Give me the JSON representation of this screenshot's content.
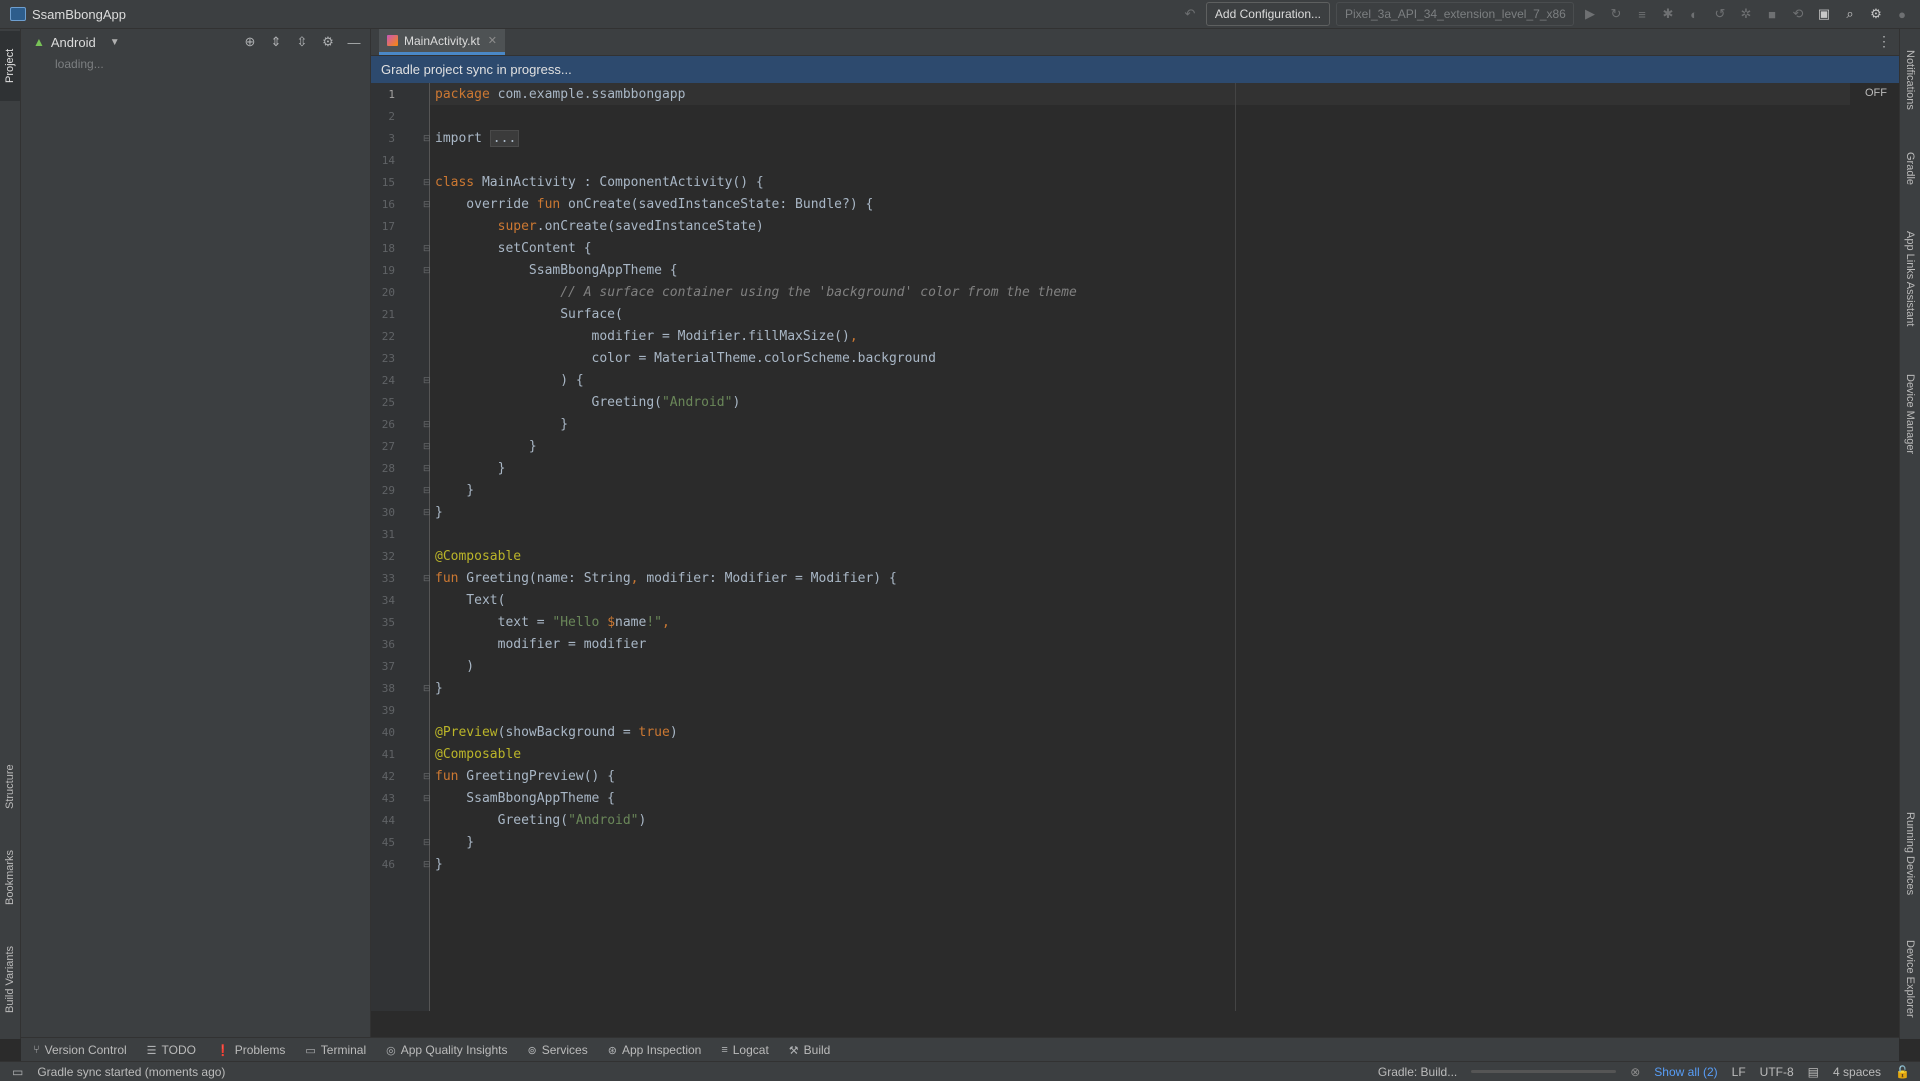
{
  "window": {
    "title": "SsamBbongApp"
  },
  "toolbar": {
    "add_configuration": "Add Configuration...",
    "device": "Pixel_3a_API_34_extension_level_7_x86"
  },
  "left_strip": {
    "project": "Project",
    "structure": "Structure",
    "bookmarks": "Bookmarks",
    "build_variants": "Build Variants"
  },
  "right_strip": {
    "notifications": "Notifications",
    "gradle": "Gradle",
    "app_links": "App Links Assistant",
    "device_manager": "Device Manager",
    "running_devices": "Running Devices",
    "device_explorer": "Device Explorer"
  },
  "project_panel": {
    "view": "Android",
    "loading": "loading..."
  },
  "editor": {
    "tab": "MainActivity.kt",
    "banner": "Gradle project sync in progress...",
    "off_badge": "OFF",
    "lines": [
      {
        "n": "1",
        "code": "<span class=\"kw\">package</span> com.example.ssambbongapp"
      },
      {
        "n": "2",
        "code": ""
      },
      {
        "n": "3",
        "code": "import <span class=\"fold-text\">...</span>"
      },
      {
        "n": "14",
        "code": ""
      },
      {
        "n": "15",
        "code": "<span class=\"kw\">class</span> MainActivity : ComponentActivity() {"
      },
      {
        "n": "16",
        "code": "    override <span class=\"kw\">fun</span> onCreate(savedInstanceState: Bundle?) {"
      },
      {
        "n": "17",
        "code": "        <span class=\"kw\">super</span>.onCreate(savedInstanceState)"
      },
      {
        "n": "18",
        "code": "        setContent {"
      },
      {
        "n": "19",
        "code": "            SsamBbongAppTheme {"
      },
      {
        "n": "20",
        "code": "                <span class=\"cmt\">// A surface container using the 'background' color from the theme</span>"
      },
      {
        "n": "21",
        "code": "                Surface("
      },
      {
        "n": "22",
        "code": "                    modifier = Modifier.fillMaxSize()<span class=\"kw\">,</span>"
      },
      {
        "n": "23",
        "code": "                    color = MaterialTheme.colorScheme.background"
      },
      {
        "n": "24",
        "code": "                ) {"
      },
      {
        "n": "25",
        "code": "                    Greeting(<span class=\"str\">\"Android\"</span>)"
      },
      {
        "n": "26",
        "code": "                }"
      },
      {
        "n": "27",
        "code": "            }"
      },
      {
        "n": "28",
        "code": "        }"
      },
      {
        "n": "29",
        "code": "    }"
      },
      {
        "n": "30",
        "code": "}"
      },
      {
        "n": "31",
        "code": ""
      },
      {
        "n": "32",
        "code": "<span class=\"ann\">@Composable</span>"
      },
      {
        "n": "33",
        "code": "<span class=\"kw\">fun</span> Greeting(name: String<span class=\"kw\">,</span> modifier: Modifier = Modifier) {"
      },
      {
        "n": "34",
        "code": "    Text("
      },
      {
        "n": "35",
        "code": "        text = <span class=\"str\">\"Hello </span><span class=\"kw\">$</span>name<span class=\"str\">!\"</span><span class=\"kw\">,</span>"
      },
      {
        "n": "36",
        "code": "        modifier = modifier"
      },
      {
        "n": "37",
        "code": "    )"
      },
      {
        "n": "38",
        "code": "}"
      },
      {
        "n": "39",
        "code": ""
      },
      {
        "n": "40",
        "code": "<span class=\"ann\">@Preview</span>(showBackground = <span class=\"kw\">true</span>)"
      },
      {
        "n": "41",
        "code": "<span class=\"ann\">@Composable</span>"
      },
      {
        "n": "42",
        "code": "<span class=\"kw\">fun</span> GreetingPreview() {"
      },
      {
        "n": "43",
        "code": "    SsamBbongAppTheme {"
      },
      {
        "n": "44",
        "code": "        Greeting(<span class=\"str\">\"Android\"</span>)"
      },
      {
        "n": "45",
        "code": "    }"
      },
      {
        "n": "46",
        "code": "}"
      }
    ]
  },
  "bottom_tabs": [
    "Version Control",
    "TODO",
    "Problems",
    "Terminal",
    "App Quality Insights",
    "Services",
    "App Inspection",
    "Logcat",
    "Build"
  ],
  "status": {
    "message": "Gradle sync started (moments ago)",
    "task": "Gradle: Build...",
    "progress": 0.0,
    "show_all": "Show all (2)",
    "line_sep": "LF",
    "encoding": "UTF-8",
    "indent": "4 spaces"
  }
}
